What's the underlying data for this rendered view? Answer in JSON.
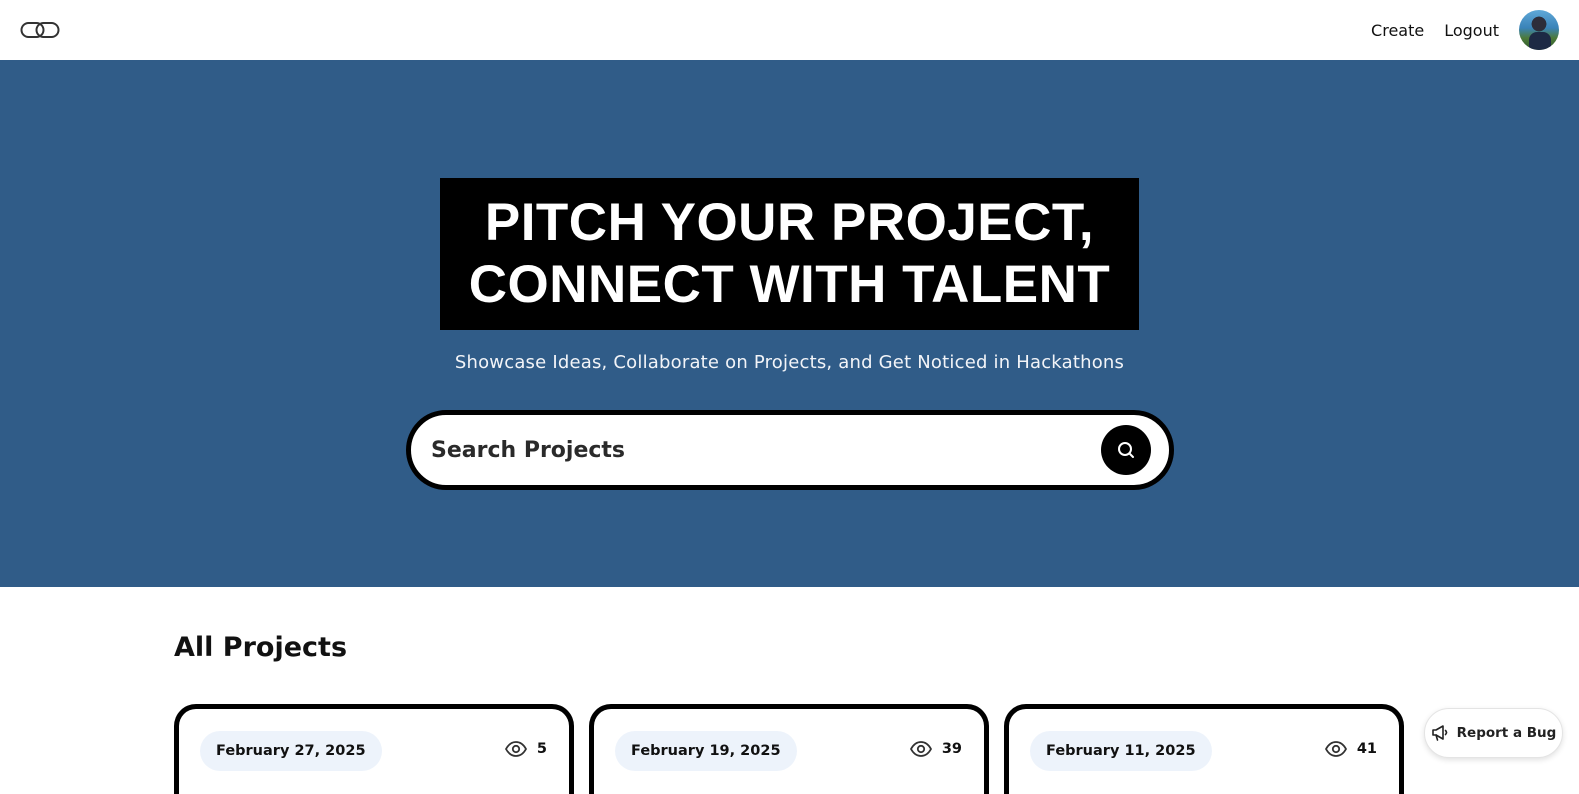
{
  "navbar": {
    "logo_icon": "chain-link-icon",
    "links": [
      {
        "label": "Create"
      },
      {
        "label": "Logout"
      }
    ],
    "avatar_icon": "user-avatar"
  },
  "hero": {
    "title_line1": "PITCH YOUR PROJECT,",
    "title_line2": "CONNECT WITH TALENT",
    "subtitle": "Showcase Ideas, Collaborate on Projects, and Get Noticed in Hackathons",
    "background_color": "#305c88",
    "search": {
      "placeholder": "Search Projects",
      "button_icon": "search-icon"
    }
  },
  "projects": {
    "section_title": "All Projects",
    "cards": [
      {
        "date": "February 27, 2025",
        "views": "5"
      },
      {
        "date": "February 19, 2025",
        "views": "39"
      },
      {
        "date": "February 11, 2025",
        "views": "41"
      }
    ]
  },
  "report_bug": {
    "label": "Report a Bug",
    "icon": "megaphone-icon"
  }
}
